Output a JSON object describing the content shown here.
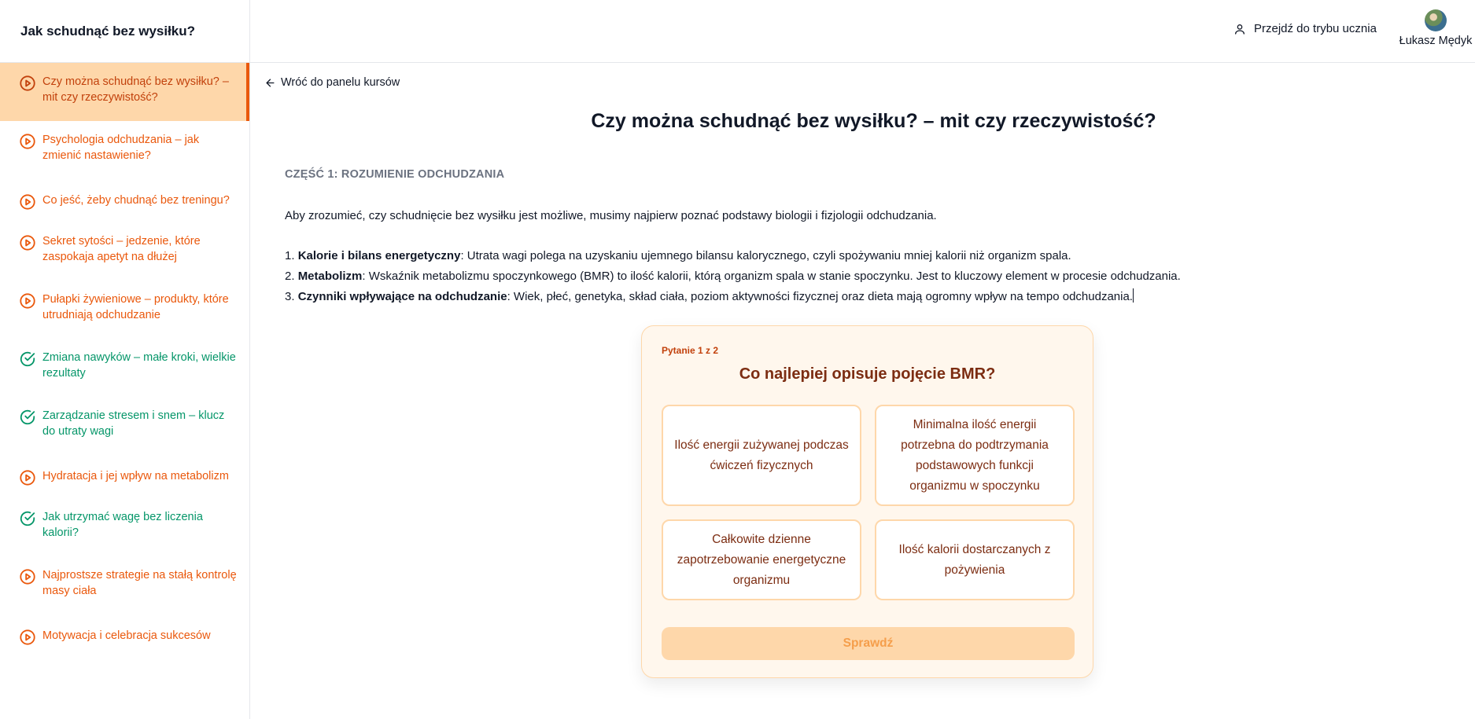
{
  "course": {
    "title": "Jak schudnąć bez wysiłku?"
  },
  "lessons": [
    {
      "label": "Czy można schudnąć bez wysiłku? – mit czy rzeczywistość?",
      "status": "play",
      "active": true
    },
    {
      "label": "Psychologia odchudzania – jak zmienić nastawienie?",
      "status": "play"
    },
    {
      "label": "Co jeść, żeby chudnąć bez treningu?",
      "status": "play"
    },
    {
      "label": "Sekret sytości – jedzenie, które zaspokaja apetyt na dłużej",
      "status": "play"
    },
    {
      "label": "Pułapki żywieniowe – produkty, które utrudniają odchudzanie",
      "status": "play"
    },
    {
      "label": "Zmiana nawyków – małe kroki, wielkie rezultaty",
      "status": "completed"
    },
    {
      "label": "Zarządzanie stresem i snem – klucz do utraty wagi",
      "status": "completed"
    },
    {
      "label": "Hydratacja i jej wpływ na metabolizm",
      "status": "play"
    },
    {
      "label": "Jak utrzymać wagę bez liczenia kalorii?",
      "status": "completed"
    },
    {
      "label": "Najprostsze strategie na stałą kontrolę masy ciała",
      "status": "play"
    },
    {
      "label": "Motywacja i celebracja sukcesów",
      "status": "play"
    }
  ],
  "header": {
    "student_mode_label": "Przejdź do trybu ucznia",
    "user_name": "Łukasz Mędyk"
  },
  "main": {
    "back_label": "Wróć do panelu kursów",
    "lesson_title": "Czy można schudnąć bez wysiłku? – mit czy rzeczywistość?",
    "section_heading": "CZĘŚĆ 1: ROZUMIENIE ODCHUDZANIA",
    "intro": "Aby zrozumieć, czy schudnięcie bez wysiłku jest możliwe, musimy najpierw poznać podstawy biologii i fizjologii odchudzania.",
    "points": [
      {
        "num": "1. ",
        "term": "Kalorie i bilans energetyczny",
        "text": ": Utrata wagi polega na uzyskaniu ujemnego bilansu kalorycznego, czyli spożywaniu mniej kalorii niż organizm spala."
      },
      {
        "num": "2. ",
        "term": "Metabolizm",
        "text": ": Wskaźnik metabolizmu spoczynkowego (BMR) to ilość kalorii, którą organizm spala w stanie spoczynku. Jest to kluczowy element w procesie odchudzania."
      },
      {
        "num": "3. ",
        "term": "Czynniki wpływające na odchudzanie",
        "text": ": Wiek, płeć, genetyka, skład ciała, poziom aktywności fizycznej oraz dieta mają ogromny wpływ na tempo odchudzania."
      }
    ]
  },
  "quiz": {
    "counter": "Pytanie 1 z 2",
    "question": "Co najlepiej opisuje pojęcie BMR?",
    "answers": [
      "Ilość energii zużywanej podczas ćwiczeń fizycznych",
      "Minimalna ilość energii potrzebna do podtrzymania podstawowych funkcji organizmu w spoczynku",
      "Całkowite dzienne zapotrzebowanie energetyczne organizmu",
      "Ilość kalorii dostarczanych z pożywienia"
    ],
    "check_label": "Sprawdź"
  },
  "colors": {
    "accent_orange": "#ea580c",
    "completed_green": "#059669",
    "active_bg": "#fed7aa",
    "quiz_text": "#7c2d12"
  }
}
